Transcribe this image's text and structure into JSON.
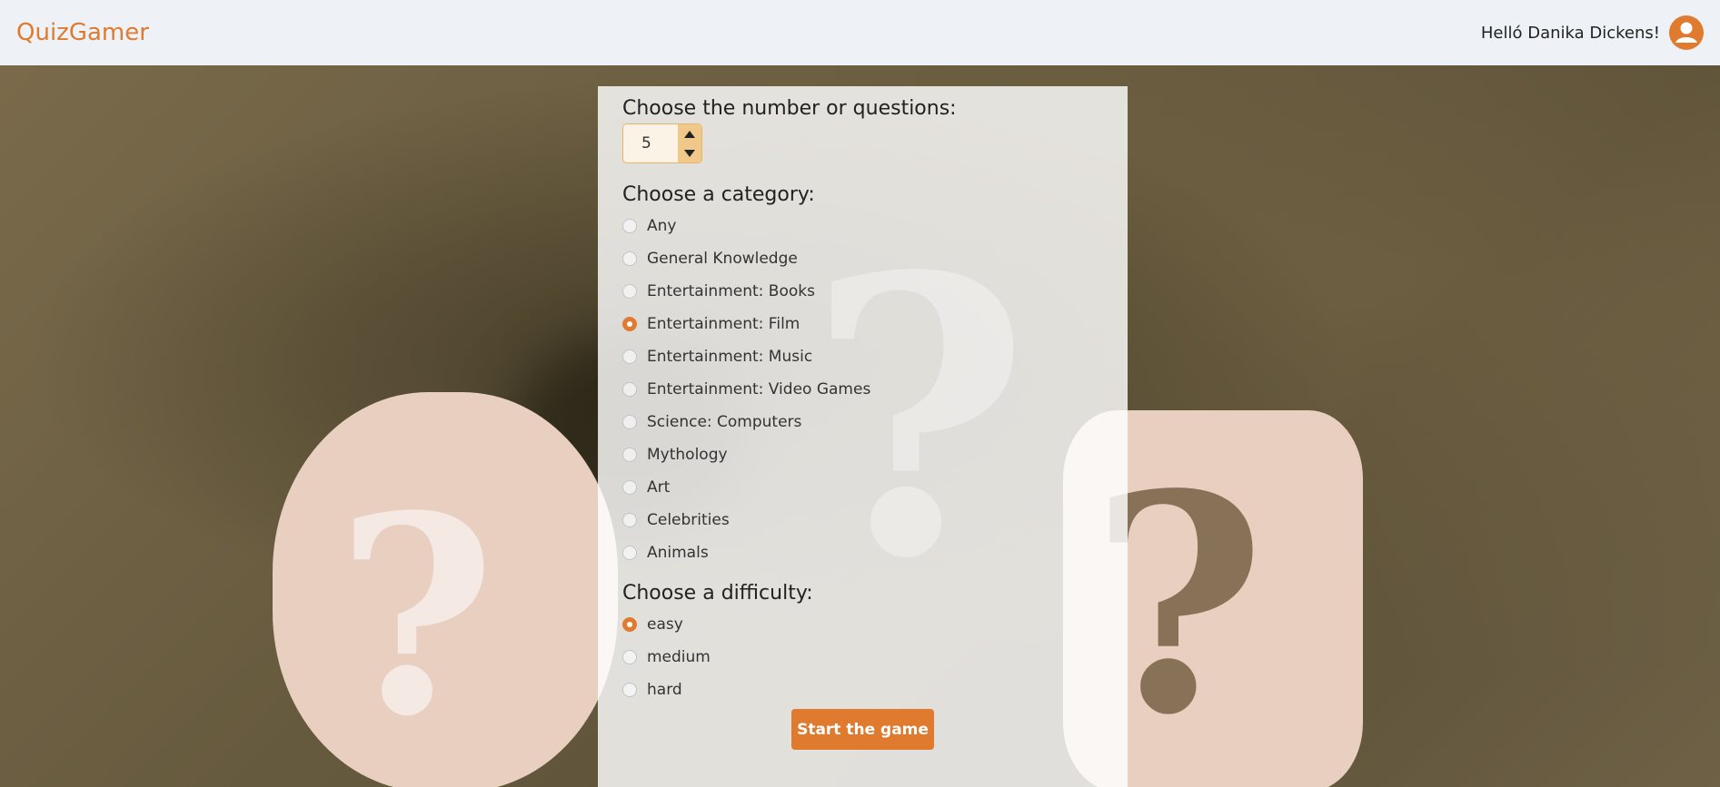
{
  "app": {
    "brand": "QuizGamer"
  },
  "header": {
    "greeting": "Helló Danika Dickens!"
  },
  "questions": {
    "title": "Choose the number or questions:",
    "value": "5"
  },
  "category": {
    "title": "Choose a category:",
    "options": [
      "Any",
      "General Knowledge",
      "Entertainment: Books",
      "Entertainment: Film",
      "Entertainment: Music",
      "Entertainment: Video Games",
      "Science: Computers",
      "Mythology",
      "Art",
      "Celebrities",
      "Animals"
    ],
    "selected": "Entertainment: Film"
  },
  "difficulty": {
    "title": "Choose a difficulty:",
    "options": [
      "easy",
      "medium",
      "hard"
    ],
    "selected": "easy"
  },
  "actions": {
    "start_label": "Start the game"
  },
  "colors": {
    "accent": "#e07a2f",
    "navbar_bg": "#eef2f7"
  }
}
